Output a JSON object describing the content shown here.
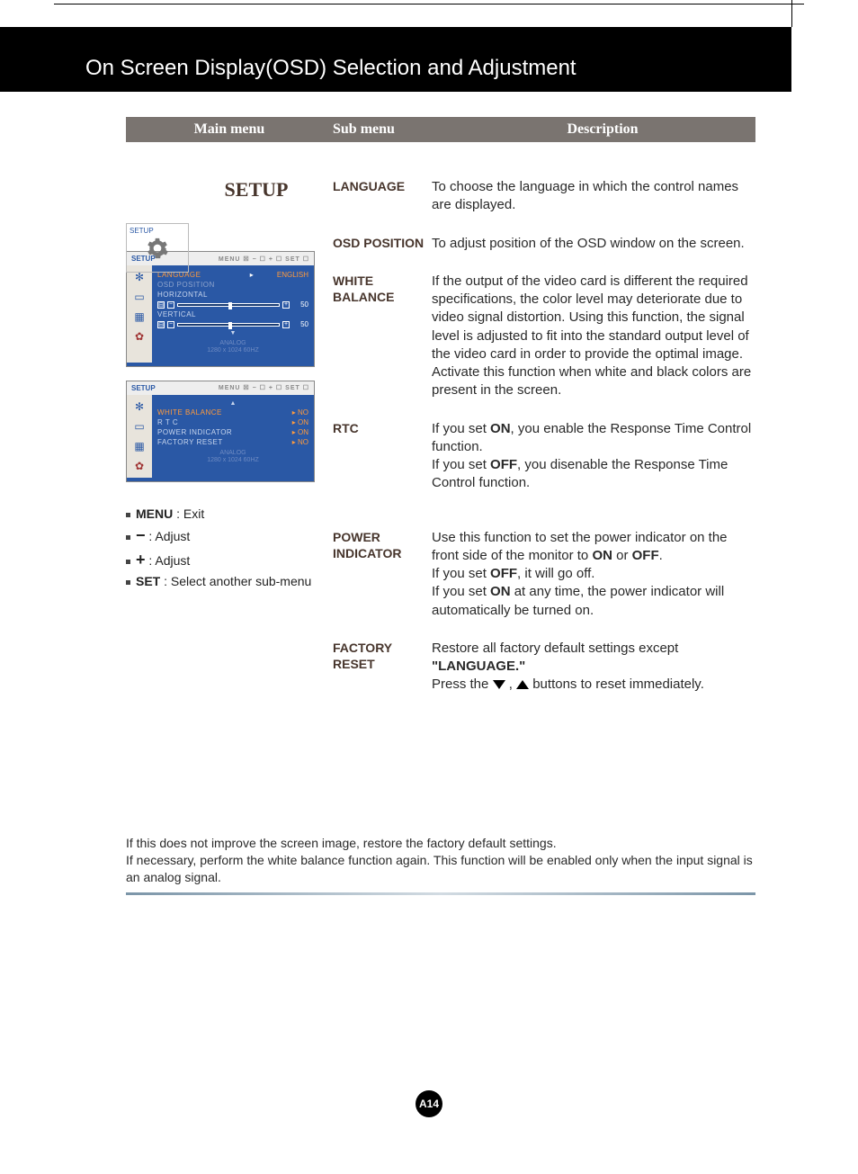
{
  "page": {
    "title": "On Screen Display(OSD) Selection and Adjustment",
    "page_number": "A14"
  },
  "header": {
    "col1": "Main menu",
    "col2": "Sub menu",
    "col3": "Description"
  },
  "setup": {
    "icon_label": "SETUP",
    "title": "SETUP"
  },
  "osd1": {
    "title": "SETUP",
    "topbar_buttons": "MENU ☒   − ☐   + ☐   SET ☐",
    "items": {
      "language_label": "LANGUAGE",
      "language_value": "ENGLISH",
      "osd_position": "OSD  POSITION",
      "horizontal": "HORIZONTAL",
      "vertical": "VERTICAL",
      "h_val": "50",
      "v_val": "50"
    },
    "footer1": "ANALOG",
    "footer2": "1280 x 1024  60HZ"
  },
  "osd2": {
    "title": "SETUP",
    "topbar_buttons": "MENU ☒   − ☐   + ☐   SET ☐",
    "items": {
      "white_balance": "WHITE  BALANCE",
      "white_balance_val": "▸ NO",
      "rtc": "R T C",
      "rtc_val": "▸ ON",
      "power_indicator": "POWER  INDICATOR",
      "power_indicator_val": "▸ ON",
      "factory_reset": "FACTORY  RESET",
      "factory_reset_val": "▸ NO"
    },
    "footer1": "ANALOG",
    "footer2": "1280 x 1024  60HZ"
  },
  "controls": {
    "menu": "MENU",
    "menu_text": " : Exit",
    "minus": "−",
    "minus_text": "   : Adjust",
    "plus": "+",
    "plus_text": "   : Adjust",
    "set": "SET",
    "set_text": " : Select another sub-menu"
  },
  "rows": {
    "language": {
      "label": "LANGUAGE",
      "text": "To choose the language in which the control names are displayed."
    },
    "osd_position": {
      "label": "OSD POSITION",
      "text": "To adjust position of the OSD window on the screen."
    },
    "white_balance": {
      "label": "WHITE BALANCE",
      "text": "If the output of the video card is different the required specifications, the color level may deteriorate due to video signal distortion. Using this function, the signal level is adjusted to fit into the standard output level of the video card in order to provide the optimal image. Activate this function when white and black colors are present in the screen."
    },
    "rtc": {
      "label": "RTC",
      "text_1": "If you set ",
      "on": "ON",
      "text_2": ", you enable the Response Time Control function.",
      "text_3": "If you set ",
      "off": "OFF",
      "text_4": ", you disenable the Response Time Control function."
    },
    "power_indicator": {
      "label": "POWER INDICATOR",
      "text_1": "Use this function to set the power indicator on the front side of the monitor to ",
      "on": "ON",
      "or": " or ",
      "off": "OFF",
      "dot": ".",
      "text_2": "If you set ",
      "off2": "OFF",
      "text_3": ", it will go off.",
      "text_4": "If you set ",
      "on2": "ON",
      "text_5": " at any time, the power indicator will automatically be turned on."
    },
    "factory_reset": {
      "label": "FACTORY RESET",
      "text_1": "Restore all factory default settings except ",
      "lang": "\"LANGUAGE.\"",
      "text_2": "Press the ",
      "comma": " , ",
      "text_3": " buttons to reset immediately."
    }
  },
  "bottom_note": "If this does not improve the screen image, restore the factory default settings.\nIf necessary, perform the white balance function again. This function will be enabled only when the input signal is an analog signal."
}
